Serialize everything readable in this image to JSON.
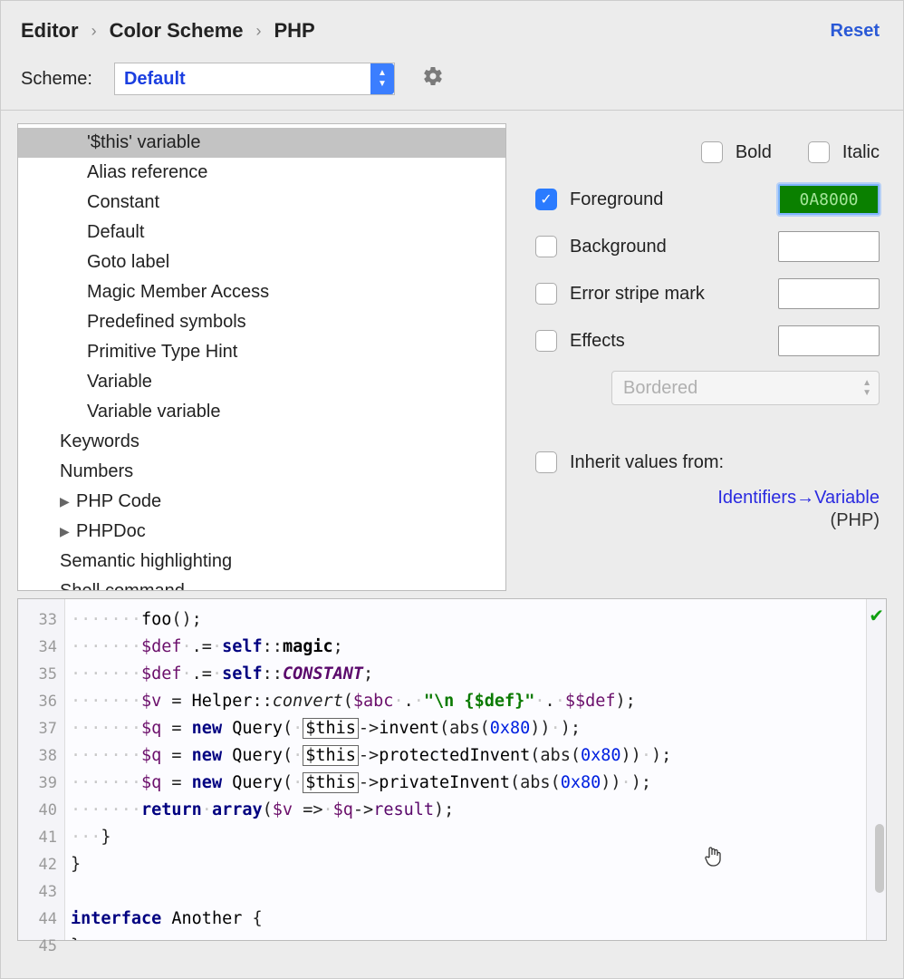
{
  "breadcrumb": {
    "a": "Editor",
    "b": "Color Scheme",
    "c": "PHP"
  },
  "reset": "Reset",
  "scheme": {
    "label": "Scheme:",
    "value": "Default"
  },
  "tree": {
    "i0": "'$this' variable",
    "i1": "Alias reference",
    "i2": "Constant",
    "i3": "Default",
    "i4": "Goto label",
    "i5": "Magic Member Access",
    "i6": "Predefined symbols",
    "i7": "Primitive Type Hint",
    "i8": "Variable",
    "i9": "Variable variable",
    "i10": "Keywords",
    "i11": "Numbers",
    "i12": "PHP Code",
    "i13": "PHPDoc",
    "i14": "Semantic highlighting",
    "i15": "Shell command"
  },
  "opt": {
    "bold": "Bold",
    "italic": "Italic",
    "fg": "Foreground",
    "fgval": "0A8000",
    "bg": "Background",
    "stripe": "Error stripe mark",
    "effects": "Effects",
    "effectsType": "Bordered",
    "inherit": "Inherit values from:",
    "inheritLink1": "Identifiers",
    "inheritLink2": "Variable",
    "inheritSub": "(PHP)"
  },
  "gutter": {
    "l33": "33",
    "l34": "34",
    "l35": "35",
    "l36": "36",
    "l37": "37",
    "l38": "38",
    "l39": "39",
    "l40": "40",
    "l41": "41",
    "l42": "42",
    "l43": "43",
    "l44": "44",
    "l45": "45"
  },
  "code": {
    "foo": "foo",
    "def": "$def",
    "self": "self",
    "magic": "magic",
    "CONSTANT": "CONSTANT",
    "v": "$v",
    "Helper": "Helper",
    "convert": "convert",
    "abc": "$abc",
    "str": "\"\\n {$def}\"",
    "ddef": "$$def",
    "q": "$q",
    "new": "new",
    "Query": "Query",
    "this": "$this",
    "invent": "invent",
    "protectedInvent": "protectedInvent",
    "privateInvent": "privateInvent",
    "abs": "abs",
    "hex": "0x80",
    "return": "return",
    "array": "array",
    "result": "result",
    "interface": "interface",
    "Another": "Another"
  }
}
